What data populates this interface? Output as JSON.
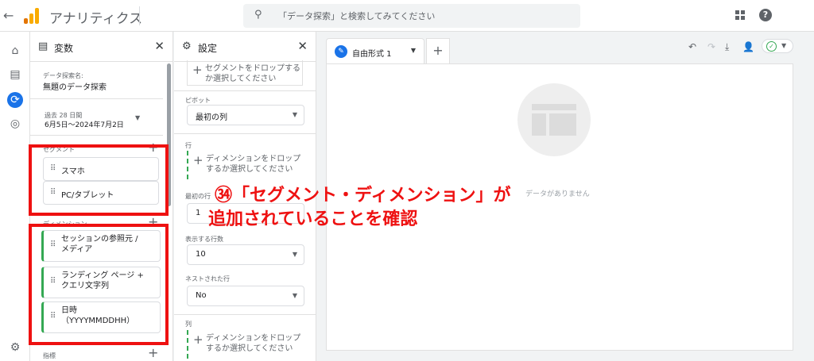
{
  "app": {
    "title": "アナリティクス",
    "back_icon": "arrow-left-icon"
  },
  "search": {
    "placeholder": "「データ探索」と検索してみてください"
  },
  "variables_panel": {
    "title": "変数",
    "exploration_name_label": "データ探索名:",
    "exploration_name": "無題のデータ探索",
    "date_range_label": "過去 28 日間",
    "date_range": "6月5日～2024年7月2日",
    "segments_label": "セグメント",
    "segments": [
      "スマホ",
      "PC/タブレット"
    ],
    "dimensions_label": "ディメンション",
    "dimensions": [
      [
        "セッションの参照元 /",
        "メディア"
      ],
      [
        "ランディング ページ +",
        "クエリ文字列"
      ],
      [
        "日時",
        "（YYYYMMDDHH）"
      ]
    ],
    "metrics_label": "指標"
  },
  "settings_panel": {
    "title": "設定",
    "segment_drop": [
      "セグメントをドロップする",
      "か選択してください"
    ],
    "pivot_label": "ピボット",
    "pivot_value": "最初の列",
    "rows_label": "行",
    "rows_drop": [
      "ディメンションをドロップ",
      "するか選択してください"
    ],
    "first_row_label": "最初の行",
    "first_row_value": "1",
    "show_rows_label": "表示する行数",
    "show_rows_value": "10",
    "nested_rows_label": "ネストされた行",
    "nested_rows_value": "No",
    "columns_label": "列",
    "columns_drop": [
      "ディメンションをドロップ",
      "するか選択してください"
    ]
  },
  "canvas": {
    "tab_label": "自由形式 1",
    "empty_text": "データがありません"
  },
  "annotation": {
    "line1": "㉞「セグメント・ディメンション」が",
    "line2": "追加されていることを確認"
  },
  "colors": {
    "accent": "#1a73e8",
    "annotation": "#ee1111",
    "green": "#34a853"
  }
}
